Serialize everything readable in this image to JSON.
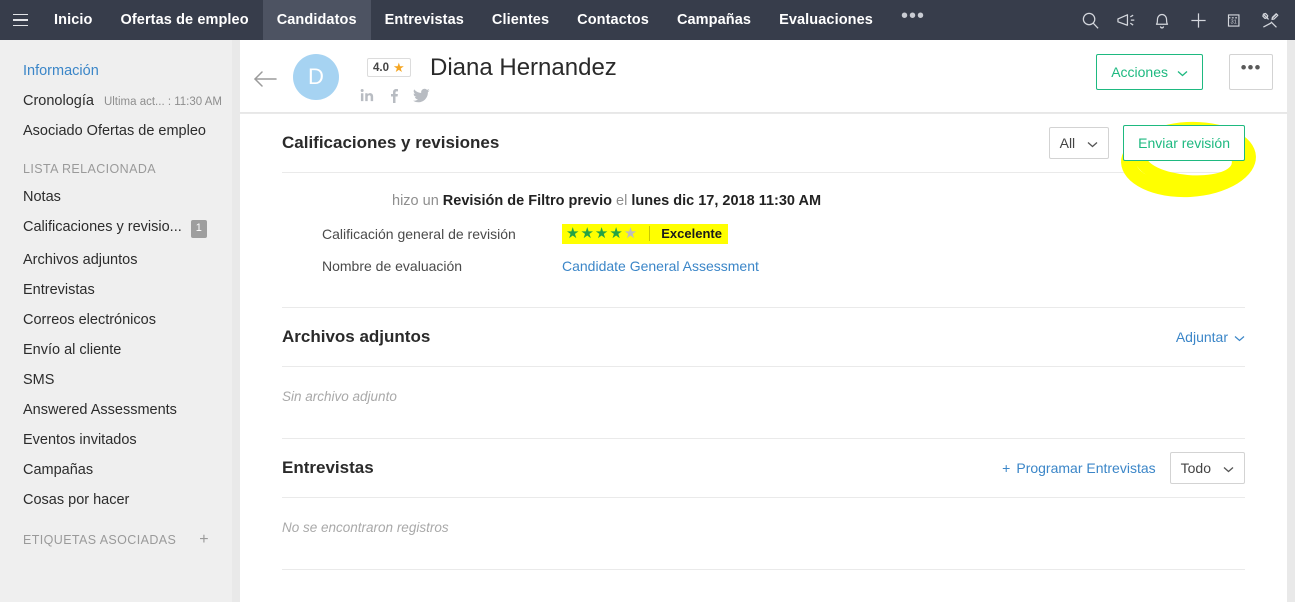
{
  "topnav": {
    "menu_icon": "hamburger-icon",
    "items": [
      {
        "label": "Inicio",
        "active": false
      },
      {
        "label": "Ofertas de empleo",
        "active": false
      },
      {
        "label": "Candidatos",
        "active": true
      },
      {
        "label": "Entrevistas",
        "active": false
      },
      {
        "label": "Clientes",
        "active": false
      },
      {
        "label": "Contactos",
        "active": false
      },
      {
        "label": "Campañas",
        "active": false
      },
      {
        "label": "Evaluaciones",
        "active": false
      }
    ],
    "overflow_label": "•••",
    "icons": [
      "search-icon",
      "announcement-icon",
      "notifications-bell-icon",
      "add-icon",
      "calendar-icon",
      "tools-icon"
    ]
  },
  "sidebar": {
    "top_items": [
      {
        "label": "Información",
        "selected": true,
        "meta": ""
      },
      {
        "label": "Cronología",
        "selected": false,
        "meta": "Ultima act... : 11:30 AM"
      },
      {
        "label": "Asociado Ofertas de empleo",
        "selected": false,
        "meta": ""
      }
    ],
    "related_header": "LISTA RELACIONADA",
    "related_items": [
      {
        "label": "Notas",
        "badge": ""
      },
      {
        "label": "Calificaciones y revisio...",
        "badge": "1"
      },
      {
        "label": "Archivos adjuntos",
        "badge": ""
      },
      {
        "label": "Entrevistas",
        "badge": ""
      },
      {
        "label": "Correos electrónicos",
        "badge": ""
      },
      {
        "label": "Envío al cliente",
        "badge": ""
      },
      {
        "label": "SMS",
        "badge": ""
      },
      {
        "label": "Answered Assessments",
        "badge": ""
      },
      {
        "label": "Eventos invitados",
        "badge": ""
      },
      {
        "label": "Campañas",
        "badge": ""
      },
      {
        "label": "Cosas por hacer",
        "badge": ""
      }
    ],
    "tags_header": "ETIQUETAS ASOCIADAS",
    "tags_add": "+"
  },
  "candidate": {
    "back_icon": "back-arrow-icon",
    "avatar_initial": "D",
    "rating_value": "4.0",
    "rating_star": "★",
    "name": "Diana Hernandez",
    "social": [
      "linkedin-icon",
      "facebook-icon",
      "twitter-icon"
    ],
    "actions_label": "Acciones",
    "more_label": "•••"
  },
  "reviews_panel": {
    "title": "Calificaciones y revisiones",
    "filter_value": "All",
    "submit_label": "Enviar revisión",
    "entry": {
      "prefix": "hizo un",
      "type": "Revisión de Filtro previo",
      "connector": "el",
      "datetime": "lunes dic 17, 2018 11:30 AM"
    },
    "rows": [
      {
        "label": "Calificación general de revisión",
        "stars_on": 4,
        "stars_total": 5,
        "value": "Excelente",
        "highlighted": true
      },
      {
        "label": "Nombre de evaluación",
        "value": "Candidate General Assessment",
        "link": true
      }
    ]
  },
  "attachments_panel": {
    "title": "Archivos adjuntos",
    "action_label": "Adjuntar",
    "empty_text": "Sin archivo adjunto"
  },
  "interviews_panel": {
    "title": "Entrevistas",
    "action_label": "Programar Entrevistas",
    "action_plus": "+",
    "filter_value": "Todo",
    "empty_text": "No se encontraron registros"
  },
  "colors": {
    "navbar": "#373d4b",
    "nav_active": "#4d5362",
    "sidebar": "#efefef",
    "accent_green": "#1eb980",
    "link_blue": "#3b86c8",
    "highlight_yellow": "#ffff00",
    "star_green": "#25a344",
    "star_grey": "#bdbdbd",
    "avatar_blue": "#a6d3f2",
    "rating_star_orange": "#f5a623"
  }
}
